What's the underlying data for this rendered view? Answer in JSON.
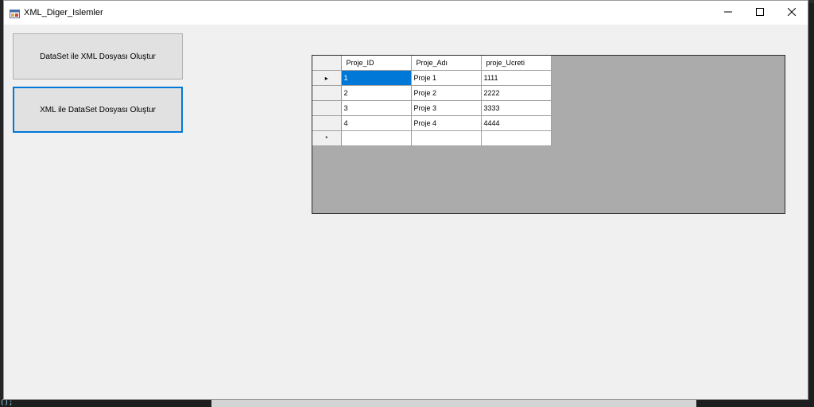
{
  "window": {
    "title": "XML_Diger_Islemler"
  },
  "background": {
    "code_fragment": "();"
  },
  "buttons": {
    "create_xml": "DataSet ile XML Dosyası Oluştur",
    "create_dataset": "XML ile DataSet Dosyası Oluştur"
  },
  "grid": {
    "columns": [
      "Proje_ID",
      "Proje_Adı",
      "proje_Ucreti"
    ],
    "rows": [
      [
        "1",
        "Proje 1",
        "1111"
      ],
      [
        "2",
        "Proje 2",
        "2222"
      ],
      [
        "3",
        "Proje 3",
        "3333"
      ],
      [
        "4",
        "Proje 4",
        "4444"
      ]
    ],
    "current_row_marker": "▸",
    "new_row_marker": "*"
  },
  "colors": {
    "selection": "#0078d7",
    "grid_background": "#ababab",
    "form_background": "#f0f0f0"
  },
  "icons": {
    "window_controls": [
      "minimize-icon",
      "maximize-icon",
      "close-icon"
    ],
    "app": "form-icon"
  }
}
